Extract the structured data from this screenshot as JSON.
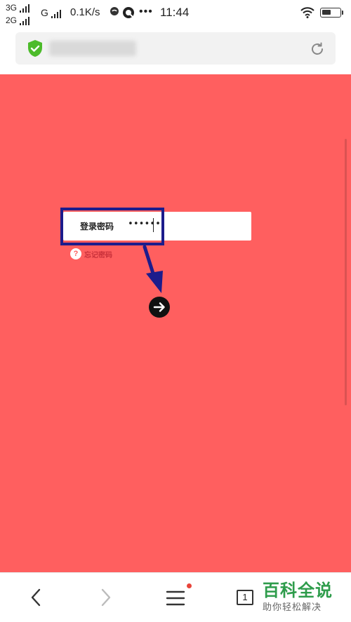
{
  "status_bar": {
    "network1": "3G",
    "network2": "2G",
    "network3": "G",
    "speed": "0.1K/s",
    "overflow": "•••",
    "time": "11:44"
  },
  "address_bar": {
    "secure_icon": "shield-check-icon",
    "reload_icon": "reload-icon"
  },
  "login": {
    "password_label": "登录密码",
    "password_value": "••••••",
    "forgot_icon_glyph": "?",
    "forgot_label": "忘记密码",
    "submit_icon": "arrow-right-icon"
  },
  "bottom_nav": {
    "back_icon": "chevron-left-icon",
    "forward_icon": "chevron-right-icon",
    "menu_icon": "menu-icon",
    "tab_count": "1"
  },
  "watermark": {
    "title": "百科全说",
    "subtitle": "助你轻松解决"
  },
  "colors": {
    "page_background": "#ff5f5f",
    "highlight_border": "#1c1c8c",
    "secure_green": "#4cbb2a",
    "watermark_green": "#2e9c4b",
    "notification_dot": "#e8443a"
  }
}
